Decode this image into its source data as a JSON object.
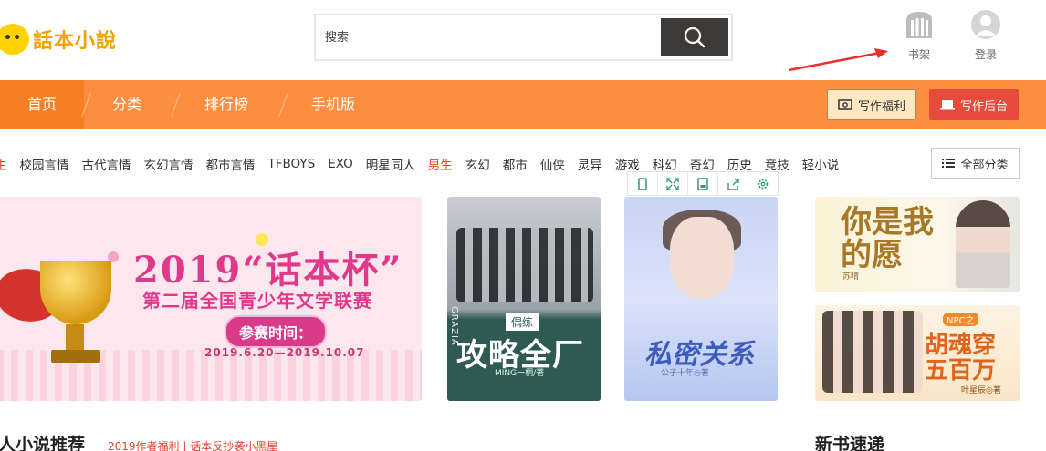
{
  "header": {
    "logo_text": "話本小說",
    "search": {
      "placeholder": "搜索"
    },
    "tools": [
      {
        "label": "书架",
        "icon": "bookshelf-icon"
      },
      {
        "label": "登录",
        "icon": "avatar-icon"
      }
    ]
  },
  "nav": {
    "items": [
      "首页",
      "分类",
      "排行榜",
      "手机版"
    ],
    "welfare_button": "写作福利",
    "backend_button": "写作后台"
  },
  "categories": {
    "items": [
      {
        "label": "生",
        "highlight": true
      },
      {
        "label": "校园言情",
        "highlight": false
      },
      {
        "label": "古代言情",
        "highlight": false
      },
      {
        "label": "玄幻言情",
        "highlight": false
      },
      {
        "label": "都市言情",
        "highlight": false
      },
      {
        "label": "TFBOYS",
        "highlight": false
      },
      {
        "label": "EXO",
        "highlight": false
      },
      {
        "label": "明星同人",
        "highlight": false
      },
      {
        "label": "男生",
        "highlight": true
      },
      {
        "label": "玄幻",
        "highlight": false
      },
      {
        "label": "都市",
        "highlight": false
      },
      {
        "label": "仙侠",
        "highlight": false
      },
      {
        "label": "灵异",
        "highlight": false
      },
      {
        "label": "游戏",
        "highlight": false
      },
      {
        "label": "科幻",
        "highlight": false
      },
      {
        "label": "奇幻",
        "highlight": false
      },
      {
        "label": "历史",
        "highlight": false
      },
      {
        "label": "竞技",
        "highlight": false
      },
      {
        "label": "轻小说",
        "highlight": false
      }
    ],
    "all_button": "全部分类"
  },
  "banner": {
    "title": "2019“话本杯”",
    "subtitle": "第二届全国青少年文学联赛",
    "pill": "参赛时间：",
    "date": "2019.6.20—2019.10.07"
  },
  "covers": {
    "c1": {
      "tag": "偶练",
      "title": "攻略全厂",
      "author": "MING一桐/著",
      "side": "GRAZIA"
    },
    "c2": {
      "title": "私密关系",
      "author": "公子十年◎著"
    },
    "c3": {
      "title": "你是我的愿",
      "author": "苏晴"
    },
    "c4": {
      "npc": "NPC之",
      "title": "胡魂穿五百万",
      "author": "叶星辰◎著"
    }
  },
  "sections": {
    "recommend_title": "人小说推荐",
    "recommend_links": "2019作者福利 | 话本反抄袭小黑屋",
    "new_books_title": "新书速递"
  },
  "colors": {
    "nav_bg": "#fd8d3f",
    "nav_active": "#f57f22",
    "highlight_red": "#e8412e",
    "backend_btn": "#e84a3c",
    "welfare_btn": "#fde8c2",
    "search_btn": "#3d3a37"
  }
}
